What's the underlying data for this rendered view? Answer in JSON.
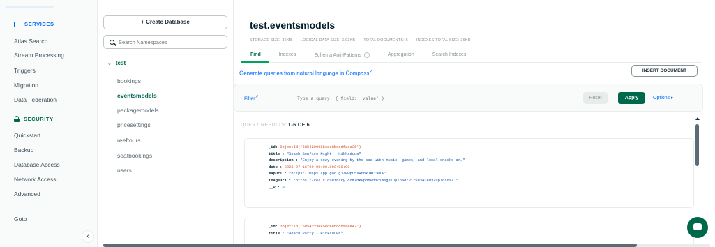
{
  "nav": {
    "services_label": "SERVICES",
    "services_items": [
      "Atlas Search",
      "Stream Processing",
      "Triggers",
      "Migration",
      "Data Federation"
    ],
    "security_label": "SECURITY",
    "security_items": [
      "Quickstart",
      "Backup",
      "Database Access",
      "Network Access",
      "Advanced"
    ],
    "goto_label": "Goto",
    "collapse_glyph": "‹"
  },
  "db_panel": {
    "create_label": "+ Create Database",
    "search_placeholder": "Search Namespaces",
    "database": "test",
    "collections": [
      "bookings",
      "eventsmodels",
      "packagemodels",
      "pricesettings",
      "reeftours",
      "seatbookings",
      "users"
    ],
    "active_collection": "eventsmodels"
  },
  "main": {
    "title": "test.eventsmodels",
    "stats": [
      "STORAGE SIZE: 36KB",
      "LOGICAL DATA SIZE: 3.03KB",
      "TOTAL DOCUMENTS: 6",
      "INDEXES TOTAL SIZE: 36KB"
    ],
    "tabs": [
      "Find",
      "Indexes",
      "Schema Anti-Patterns",
      "Aggregation",
      "Search Indexes"
    ],
    "active_tab": "Find",
    "nl_link": "Generate queries from natural language in Compass",
    "insert_label": "INSERT DOCUMENT",
    "filter_label": "Filter",
    "query_placeholder": "Type a query: { field: 'value' }",
    "reset_label": "Reset",
    "apply_label": "Apply",
    "options_label": "Options ▸",
    "results_prefix": "QUERY RESULTS: ",
    "results_count": "1-6 OF 6"
  },
  "documents": [
    {
      "id_key": "_id:",
      "id_val": "ObjectId('6854200985ede8bdcdfaee36')",
      "title_key": "title :",
      "title_val": "\"Beach Bonfire Night - Hikkaduwa\"",
      "desc_key": "description :",
      "desc_val": "\"Enjoy a cozy evening by the sea with music, games, and local snacks ar…\"",
      "date_key": "date :",
      "date_val": "2025-07-16T00:00:00.000+00:00",
      "map_key": "mapUrl :",
      "map_val": "\"https://maps.app.goo.gl/HwpC5XH6hkJKCCKXA\"",
      "img_key": "imageUrl :",
      "img_val": "\"https://res.cloudinary.com/dk8phb8dh/image/upload/v1750343803/uploads/…\"",
      "v_key": "__v :",
      "v_val": "0"
    },
    {
      "id_key": "_id:",
      "id_val": "ObjectId('6854223e85ede8bdcdfaee47')",
      "title_key": "title :",
      "title_val": "\"Beach Party - Hikkaduwa\""
    }
  ],
  "colors": {
    "accent_green": "#00684a",
    "link_blue": "#016bf8"
  }
}
